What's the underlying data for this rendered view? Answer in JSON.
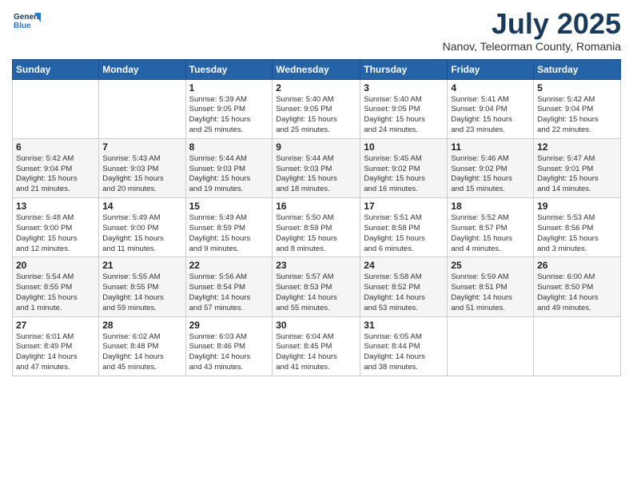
{
  "header": {
    "logo_line1": "General",
    "logo_line2": "Blue",
    "month": "July 2025",
    "location": "Nanov, Teleorman County, Romania"
  },
  "weekdays": [
    "Sunday",
    "Monday",
    "Tuesday",
    "Wednesday",
    "Thursday",
    "Friday",
    "Saturday"
  ],
  "weeks": [
    [
      {
        "num": "",
        "detail": ""
      },
      {
        "num": "",
        "detail": ""
      },
      {
        "num": "1",
        "detail": "Sunrise: 5:39 AM\nSunset: 9:05 PM\nDaylight: 15 hours\nand 25 minutes."
      },
      {
        "num": "2",
        "detail": "Sunrise: 5:40 AM\nSunset: 9:05 PM\nDaylight: 15 hours\nand 25 minutes."
      },
      {
        "num": "3",
        "detail": "Sunrise: 5:40 AM\nSunset: 9:05 PM\nDaylight: 15 hours\nand 24 minutes."
      },
      {
        "num": "4",
        "detail": "Sunrise: 5:41 AM\nSunset: 9:04 PM\nDaylight: 15 hours\nand 23 minutes."
      },
      {
        "num": "5",
        "detail": "Sunrise: 5:42 AM\nSunset: 9:04 PM\nDaylight: 15 hours\nand 22 minutes."
      }
    ],
    [
      {
        "num": "6",
        "detail": "Sunrise: 5:42 AM\nSunset: 9:04 PM\nDaylight: 15 hours\nand 21 minutes."
      },
      {
        "num": "7",
        "detail": "Sunrise: 5:43 AM\nSunset: 9:03 PM\nDaylight: 15 hours\nand 20 minutes."
      },
      {
        "num": "8",
        "detail": "Sunrise: 5:44 AM\nSunset: 9:03 PM\nDaylight: 15 hours\nand 19 minutes."
      },
      {
        "num": "9",
        "detail": "Sunrise: 5:44 AM\nSunset: 9:03 PM\nDaylight: 15 hours\nand 18 minutes."
      },
      {
        "num": "10",
        "detail": "Sunrise: 5:45 AM\nSunset: 9:02 PM\nDaylight: 15 hours\nand 16 minutes."
      },
      {
        "num": "11",
        "detail": "Sunrise: 5:46 AM\nSunset: 9:02 PM\nDaylight: 15 hours\nand 15 minutes."
      },
      {
        "num": "12",
        "detail": "Sunrise: 5:47 AM\nSunset: 9:01 PM\nDaylight: 15 hours\nand 14 minutes."
      }
    ],
    [
      {
        "num": "13",
        "detail": "Sunrise: 5:48 AM\nSunset: 9:00 PM\nDaylight: 15 hours\nand 12 minutes."
      },
      {
        "num": "14",
        "detail": "Sunrise: 5:49 AM\nSunset: 9:00 PM\nDaylight: 15 hours\nand 11 minutes."
      },
      {
        "num": "15",
        "detail": "Sunrise: 5:49 AM\nSunset: 8:59 PM\nDaylight: 15 hours\nand 9 minutes."
      },
      {
        "num": "16",
        "detail": "Sunrise: 5:50 AM\nSunset: 8:59 PM\nDaylight: 15 hours\nand 8 minutes."
      },
      {
        "num": "17",
        "detail": "Sunrise: 5:51 AM\nSunset: 8:58 PM\nDaylight: 15 hours\nand 6 minutes."
      },
      {
        "num": "18",
        "detail": "Sunrise: 5:52 AM\nSunset: 8:57 PM\nDaylight: 15 hours\nand 4 minutes."
      },
      {
        "num": "19",
        "detail": "Sunrise: 5:53 AM\nSunset: 8:56 PM\nDaylight: 15 hours\nand 3 minutes."
      }
    ],
    [
      {
        "num": "20",
        "detail": "Sunrise: 5:54 AM\nSunset: 8:55 PM\nDaylight: 15 hours\nand 1 minute."
      },
      {
        "num": "21",
        "detail": "Sunrise: 5:55 AM\nSunset: 8:55 PM\nDaylight: 14 hours\nand 59 minutes."
      },
      {
        "num": "22",
        "detail": "Sunrise: 5:56 AM\nSunset: 8:54 PM\nDaylight: 14 hours\nand 57 minutes."
      },
      {
        "num": "23",
        "detail": "Sunrise: 5:57 AM\nSunset: 8:53 PM\nDaylight: 14 hours\nand 55 minutes."
      },
      {
        "num": "24",
        "detail": "Sunrise: 5:58 AM\nSunset: 8:52 PM\nDaylight: 14 hours\nand 53 minutes."
      },
      {
        "num": "25",
        "detail": "Sunrise: 5:59 AM\nSunset: 8:51 PM\nDaylight: 14 hours\nand 51 minutes."
      },
      {
        "num": "26",
        "detail": "Sunrise: 6:00 AM\nSunset: 8:50 PM\nDaylight: 14 hours\nand 49 minutes."
      }
    ],
    [
      {
        "num": "27",
        "detail": "Sunrise: 6:01 AM\nSunset: 8:49 PM\nDaylight: 14 hours\nand 47 minutes."
      },
      {
        "num": "28",
        "detail": "Sunrise: 6:02 AM\nSunset: 8:48 PM\nDaylight: 14 hours\nand 45 minutes."
      },
      {
        "num": "29",
        "detail": "Sunrise: 6:03 AM\nSunset: 8:46 PM\nDaylight: 14 hours\nand 43 minutes."
      },
      {
        "num": "30",
        "detail": "Sunrise: 6:04 AM\nSunset: 8:45 PM\nDaylight: 14 hours\nand 41 minutes."
      },
      {
        "num": "31",
        "detail": "Sunrise: 6:05 AM\nSunset: 8:44 PM\nDaylight: 14 hours\nand 38 minutes."
      },
      {
        "num": "",
        "detail": ""
      },
      {
        "num": "",
        "detail": ""
      }
    ]
  ]
}
